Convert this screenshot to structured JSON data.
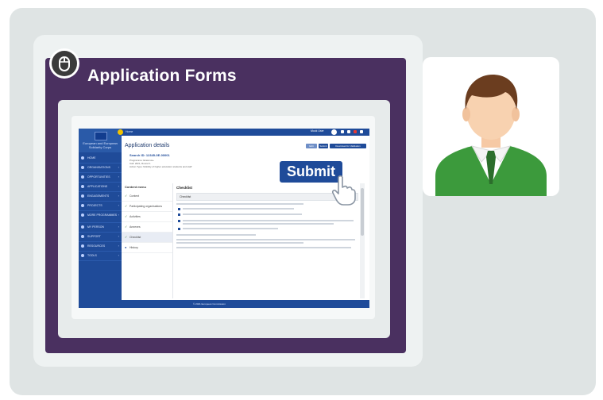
{
  "header": {
    "title": "Application Forms"
  },
  "app": {
    "topbar_text": "Home",
    "user_name": "Mock User",
    "logo_text": "European and European Solidarity Corps",
    "page_title": "Application details",
    "search_label": "Search ID: 12345-0E-00001",
    "meta_lines": [
      "Programme: Erasmus+",
      "Call: 2021, Round 1",
      "Action Type: Mobility of higher education students and staff"
    ],
    "buttons": [
      "Edit",
      "Submit",
      "Download for Validation"
    ],
    "sidebar_nav": [
      "HOME",
      "ORGANISATIONS",
      "OPPORTUNITIES",
      "APPLICATIONS",
      "ENGAGEMENTS",
      "PROJECTS",
      "MORE PROGRAMMES",
      "MY PERSON",
      "SUPPORT",
      "RESOURCES",
      "TOOLS"
    ],
    "content_menu_title": "Content menu",
    "content_menu": [
      "Context",
      "Participating organisations",
      "Activities",
      "Annexes",
      "Checklist",
      "History"
    ],
    "content_title": "Checklist",
    "content_bar": "Checklist",
    "footer_text": "© 2021 European Commission"
  },
  "overlay": {
    "submit_label": "Submit"
  },
  "icons": {
    "title_badge": "mouse-icon",
    "cursor": "hand-cursor-icon",
    "person": "person-avatar"
  },
  "colors": {
    "purple_panel": "#4a3060",
    "app_blue": "#1f4b99",
    "person_shirt": "#3c9a3c"
  }
}
